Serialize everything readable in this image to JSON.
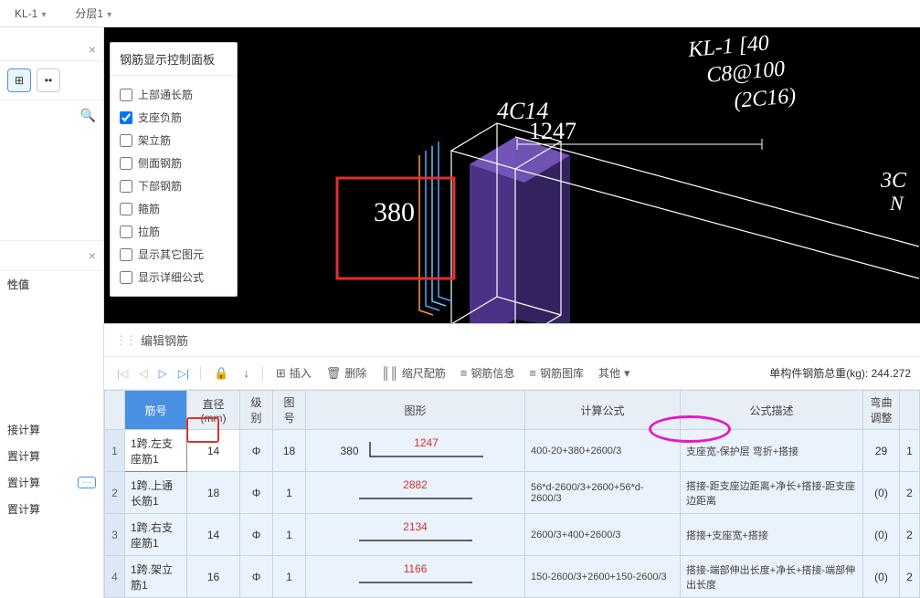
{
  "topbar": {
    "tab1": "KL-1",
    "tab2": "分层1"
  },
  "sidebar": {
    "section_header": "性值",
    "items": [
      "接计算",
      "置计算",
      "置计算",
      "置计算"
    ]
  },
  "control_panel": {
    "title": "钢筋显示控制面板",
    "options": [
      {
        "label": "上部通长筋",
        "checked": false
      },
      {
        "label": "支座负筋",
        "checked": true
      },
      {
        "label": "架立筋",
        "checked": false
      },
      {
        "label": "侧面钢筋",
        "checked": false
      },
      {
        "label": "下部钢筋",
        "checked": false
      },
      {
        "label": "箍筋",
        "checked": false
      },
      {
        "label": "拉筋",
        "checked": false
      },
      {
        "label": "显示其它图元",
        "checked": false
      },
      {
        "label": "显示详细公式",
        "checked": false
      }
    ]
  },
  "viewport_labels": {
    "box_num": "380",
    "top_text1": "4C14",
    "top_num": "1247",
    "corner1": "KL-1 [40",
    "corner2": "C8@100",
    "corner3": "(2C16)",
    "corner4": "3C",
    "corner5": "N"
  },
  "bottom_panel": {
    "title": "编辑钢筋",
    "toolbar": {
      "insert": "插入",
      "delete": "删除",
      "scale": "缩尺配筋",
      "info": "钢筋信息",
      "library": "钢筋图库",
      "other": "其他",
      "weight_label": "单构件钢筋总重(kg): ",
      "weight_value": "244.272"
    },
    "columns": [
      "",
      "筋号",
      "直径(mm)",
      "级别",
      "图号",
      "图形",
      "计算公式",
      "公式描述",
      "弯曲调整",
      ""
    ],
    "rows": [
      {
        "num": "1",
        "name": "1跨.左支座筋1",
        "diameter": "14",
        "level": "Φ",
        "shape_id": "18",
        "shape_prefix": "380",
        "shape_value": "1247",
        "formula": "400-20+380+2600/3",
        "desc": "支座宽-保护层 弯折+搭接",
        "bend": "29",
        "last": "1"
      },
      {
        "num": "2",
        "name": "1跨.上通长筋1",
        "diameter": "18",
        "level": "Φ",
        "shape_id": "1",
        "shape_prefix": "",
        "shape_value": "2882",
        "formula": "56*d-2600/3+2600+56*d-2600/3",
        "desc": "搭接-距支座边距离+净长+搭接-距支座边距离",
        "bend": "(0)",
        "last": "2"
      },
      {
        "num": "3",
        "name": "1跨.右支座筋1",
        "diameter": "14",
        "level": "Φ",
        "shape_id": "1",
        "shape_prefix": "",
        "shape_value": "2134",
        "formula": "2600/3+400+2600/3",
        "desc": "搭接+支座宽+搭接",
        "bend": "(0)",
        "last": "2"
      },
      {
        "num": "4",
        "name": "1跨.架立筋1",
        "diameter": "16",
        "level": "Φ",
        "shape_id": "1",
        "shape_prefix": "",
        "shape_value": "1166",
        "formula": "150-2600/3+2600+150-2600/3",
        "desc": "搭接-端部伸出长度+净长+搭接-端部伸出长度",
        "bend": "(0)",
        "last": "2"
      }
    ]
  }
}
